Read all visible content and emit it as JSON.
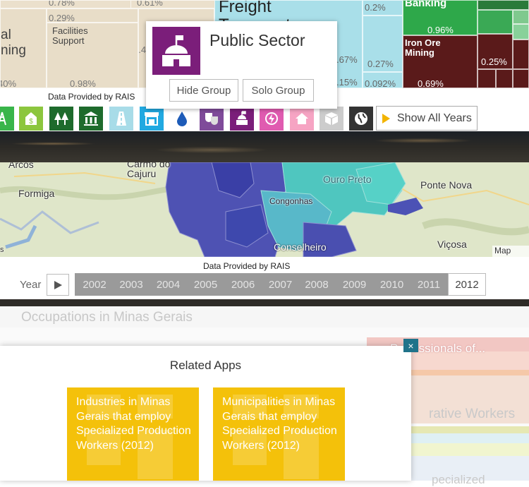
{
  "treemap": {
    "tiles": [
      {
        "name": "",
        "pct": "0.78%"
      },
      {
        "name": "",
        "pct": "0.61%"
      },
      {
        "name": "",
        "pct": "0.29%"
      },
      {
        "name": "Facilities Support",
        "pct": "0.98%"
      },
      {
        "name": "al\nning",
        "pct": "40%"
      },
      {
        "name": "",
        "pct": "0.4"
      },
      {
        "name": "Freight Transport",
        "pct": ""
      },
      {
        "name": "",
        "pct": "0.2%"
      },
      {
        "name": "",
        "pct": ".67%"
      },
      {
        "name": "",
        "pct": "0.27%"
      },
      {
        "name": "",
        "pct": ".15%"
      },
      {
        "name": "",
        "pct": "0.092%"
      },
      {
        "name": "Banking",
        "pct": "0.96%"
      },
      {
        "name": "Iron Ore Mining",
        "pct": "0.69%"
      },
      {
        "name": "",
        "pct": "0.25%"
      }
    ]
  },
  "tooltip": {
    "title": "Public Sector",
    "hide_label": "Hide Group",
    "solo_label": "Solo Group",
    "color": "#7b1e7a"
  },
  "provided_top": "Data Provided by RAIS",
  "icon_bar": {
    "icons": [
      {
        "name": "tower-icon",
        "color": "#39b54a"
      },
      {
        "name": "money-icon",
        "color": "#8cc63e"
      },
      {
        "name": "forest-icon",
        "color": "#1e6b2c"
      },
      {
        "name": "bank-icon",
        "color": "#1e6b2c"
      },
      {
        "name": "road-icon",
        "color": "#a8dce8"
      },
      {
        "name": "store-icon",
        "color": "#21a9e1"
      },
      {
        "name": "water-icon",
        "color": "#1d5bb8"
      },
      {
        "name": "theater-icon",
        "color": "#7f4b9a"
      },
      {
        "name": "public-sector-icon",
        "color": "#7b1e7a"
      },
      {
        "name": "energy-icon",
        "color": "#e05bb0"
      },
      {
        "name": "house-icon",
        "color": "#f6a4c3"
      },
      {
        "name": "box-icon",
        "color": "#cccccc"
      },
      {
        "name": "globe-icon",
        "color": "#333333"
      }
    ],
    "show_all": "Show All Years"
  },
  "map": {
    "labels": [
      "Arcos",
      "Carmo do Cajuru",
      "Formiga",
      "Ouro Preto",
      "Ponte Nova",
      "Congonhas",
      "Conselheiro",
      "Viçosa",
      "s",
      "Map data"
    ]
  },
  "provided_map": "Data Provided by RAIS",
  "year_bar": {
    "label": "Year",
    "years": [
      "2002",
      "2003",
      "2004",
      "2005",
      "2006",
      "2007",
      "2008",
      "2009",
      "2010",
      "2011",
      "2012"
    ],
    "selected": "2012"
  },
  "occupations_title": "Occupations in Minas Gerais",
  "background_labels": [
    "Professionals of...",
    "rative Workers",
    "pecialized"
  ],
  "modal": {
    "title": "Related Apps",
    "cards": [
      {
        "text": "Industries in Minas Gerais that employ Specialized Production Workers (2012)"
      },
      {
        "text": "Municipalities in Minas Gerais that employ Specialized Production Workers (2012)"
      }
    ],
    "close": "×"
  }
}
